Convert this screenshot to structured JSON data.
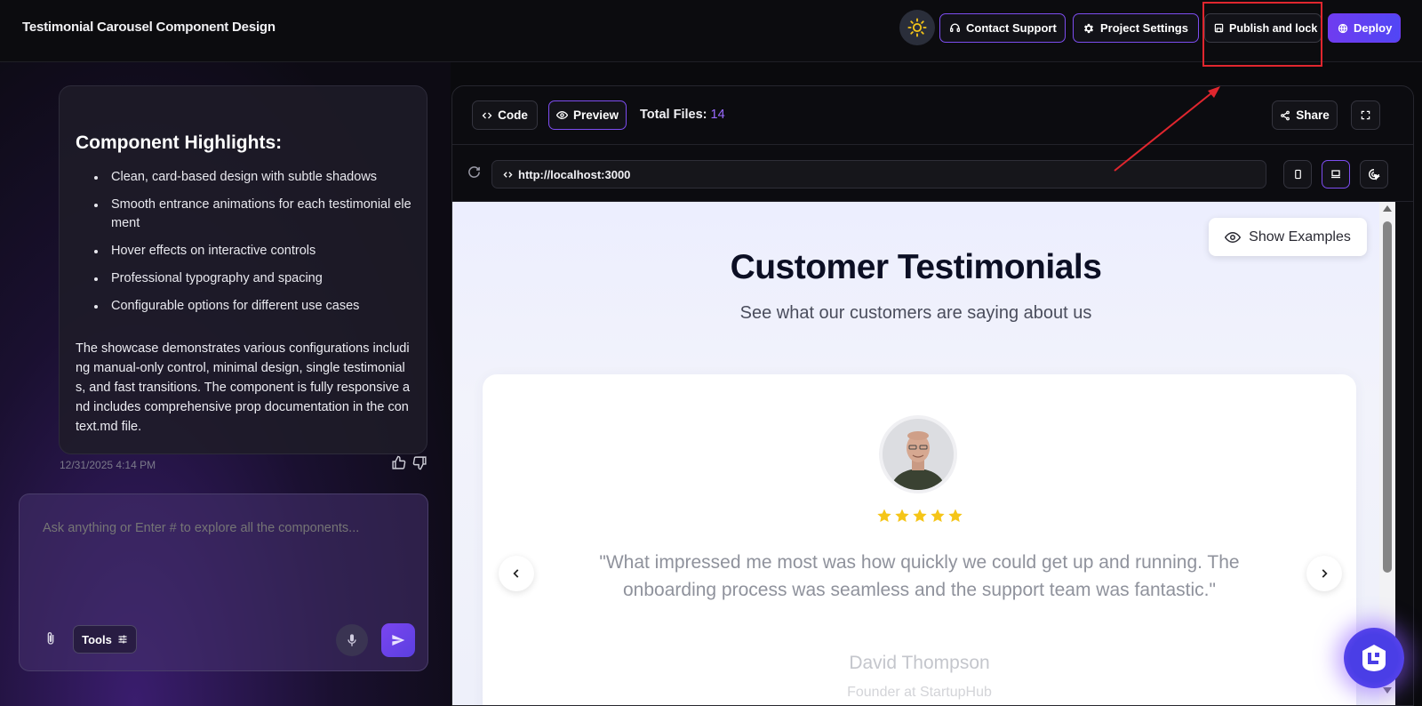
{
  "header": {
    "title": "Testimonial Carousel Component Design",
    "contact_support": "Contact Support",
    "project_settings": "Project Settings",
    "publish": "Publish and lock",
    "deploy": "Deploy"
  },
  "chat": {
    "heading": "Component Highlights:",
    "bullets": [
      "Clean, card-based design with subtle shadows",
      "Smooth entrance animations for each testimonial element",
      "Hover effects on interactive controls",
      "Professional typography and spacing",
      "Configurable options for different use cases"
    ],
    "summary": "The showcase demonstrates various configurations including manual-only control, minimal design, single testimonials, and fast transitions. The component is fully responsive and includes comprehensive prop documentation in the context.md file.",
    "timestamp": "12/31/2025 4:14 PM",
    "input_placeholder": "Ask anything or Enter # to explore all the components...",
    "tools_label": "Tools"
  },
  "preview": {
    "code_tab": "Code",
    "preview_tab": "Preview",
    "total_files_label": "Total Files:",
    "total_files_count": "14",
    "share": "Share",
    "url": "http://localhost:3000"
  },
  "site": {
    "show_examples": "Show Examples",
    "title": "Customer Testimonials",
    "subtitle": "See what our customers are saying about us",
    "rating": 5,
    "quote": "\"What impressed me most was how quickly we could get up and running. The onboarding process was seamless and the support team was fantastic.\"",
    "author_name": "David Thompson",
    "author_role": "Founder at StartupHub"
  },
  "colors": {
    "accent": "#7d4df0",
    "annotation": "#e0262e",
    "star": "#f5c518"
  }
}
